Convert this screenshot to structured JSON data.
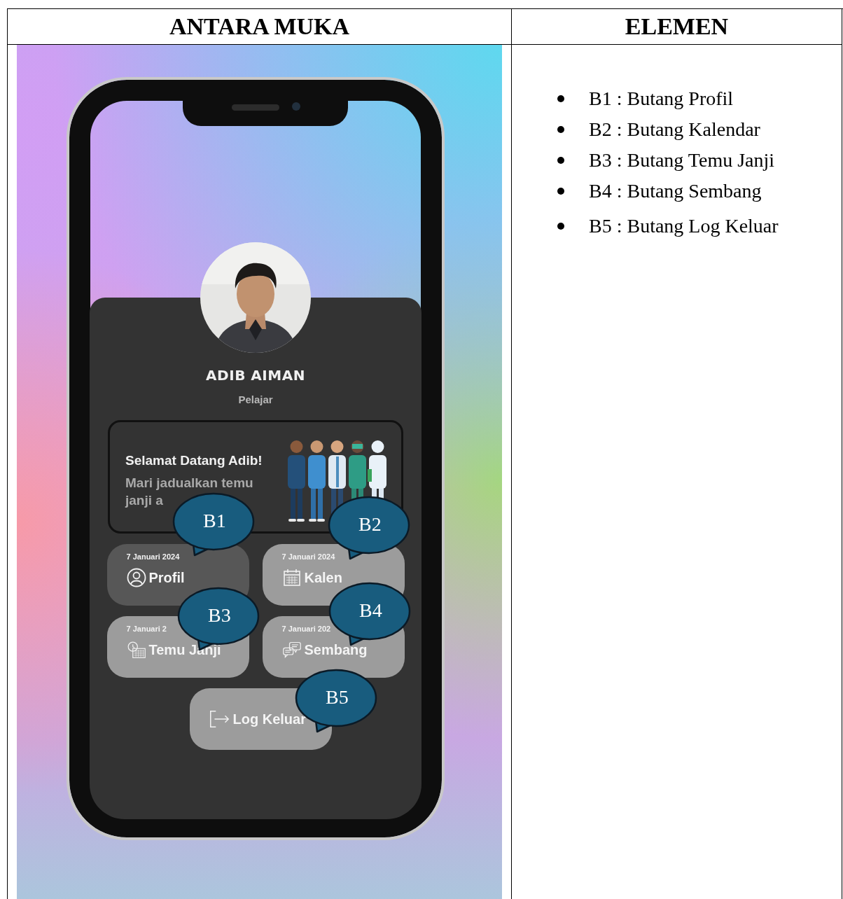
{
  "table": {
    "columns": [
      "ANTARA MUKA",
      "ELEMEN"
    ]
  },
  "phone": {
    "profile": {
      "name": "ADIB AIMAN",
      "role": "Pelajar"
    },
    "welcome": {
      "title": "Selamat Datang Adib!",
      "lines": [
        "Mari jadualkan temu",
        "janji a"
      ]
    },
    "buttons": [
      {
        "date": "7 Januari 2024",
        "label": "Profil",
        "kind": "person",
        "selected": true
      },
      {
        "date": "7 Januari 2024",
        "label": "Kalen",
        "kind": "calendar",
        "selected": false
      },
      {
        "date": "7 Januari 2",
        "label": "Temu Janji",
        "kind": "clock-calendar",
        "selected": false
      },
      {
        "date": "7 Januari 202",
        "label": "Sembang",
        "kind": "chat",
        "selected": false
      }
    ],
    "logout": {
      "label": "Log Keluar"
    }
  },
  "callouts": [
    {
      "label": "B1"
    },
    {
      "label": "B2"
    },
    {
      "label": "B3"
    },
    {
      "label": "B4"
    },
    {
      "label": "B5"
    }
  ],
  "elements": [
    "B1 : Butang Profil",
    "B2 : Butang Kalendar",
    "B3 : Butang Temu Janji",
    "B4 : Butang Sembang",
    "B5 : Butang Log Keluar"
  ]
}
